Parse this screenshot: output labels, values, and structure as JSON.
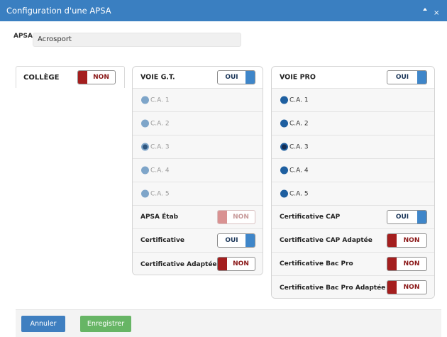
{
  "window": {
    "title": "Configuration d'une APSA"
  },
  "apsa": {
    "label": "APSA",
    "value": "Acrosport"
  },
  "college": {
    "label": "COLLÈGE",
    "toggle": "NON"
  },
  "voie_gt": {
    "header": "VOIE G.T.",
    "toggle": "OUI",
    "options": [
      {
        "label": "C.A. 1"
      },
      {
        "label": "C.A. 2"
      },
      {
        "label": "C.A. 3"
      },
      {
        "label": "C.A. 4"
      },
      {
        "label": "C.A. 5"
      }
    ],
    "selected": "C.A. 3",
    "rows": [
      {
        "label": "APSA Étab",
        "toggle": "NON"
      },
      {
        "label": "Certificative",
        "toggle": "OUI"
      },
      {
        "label": "Certificative Adaptée",
        "toggle": "NON"
      }
    ]
  },
  "voie_pro": {
    "header": "VOIE PRO",
    "toggle": "OUI",
    "options": [
      {
        "label": "C.A. 1"
      },
      {
        "label": "C.A. 2"
      },
      {
        "label": "C.A. 3"
      },
      {
        "label": "C.A. 4"
      },
      {
        "label": "C.A. 5"
      }
    ],
    "selected": "C.A. 3",
    "rows": [
      {
        "label": "Certificative CAP",
        "toggle": "OUI"
      },
      {
        "label": "Certificative CAP Adaptée",
        "toggle": "NON"
      },
      {
        "label": "Certificative Bac Pro",
        "toggle": "NON"
      },
      {
        "label": "Certificative Bac Pro Adaptée",
        "toggle": "NON"
      }
    ]
  },
  "footer": {
    "cancel_label": "Annuler",
    "save_label": "Enregistrer"
  },
  "colors": {
    "titlebar": "#3a7fc1",
    "toggle_on": "#3f86c9",
    "toggle_off": "#a41e1e",
    "cancel_button": "#3f7fc0",
    "save_button": "#67b565"
  },
  "icons": {
    "minimize": "caret-up-icon",
    "close": "close-icon"
  }
}
